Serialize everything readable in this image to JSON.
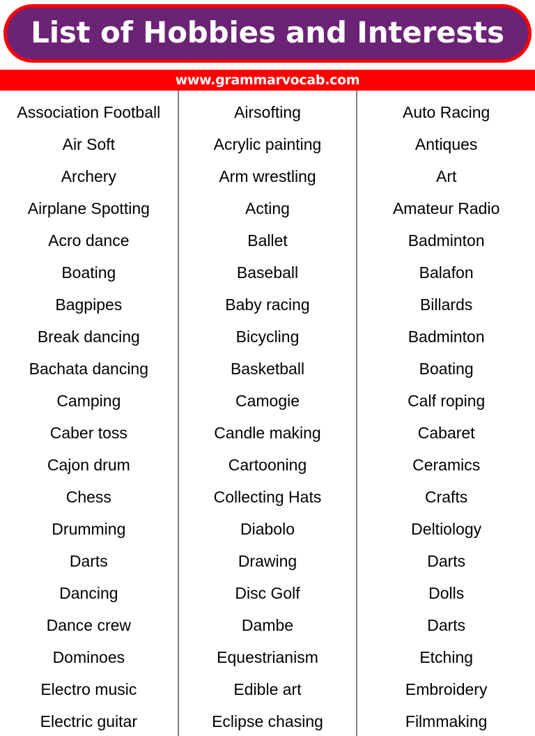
{
  "header": {
    "title": "List of Hobbies and Interests",
    "website": "www.grammarvocab.com",
    "pill_fill_color": "#6B2375",
    "pill_border_color": "#FF0000",
    "banner_color": "#FF0000",
    "title_text_color": "#FFFFFF"
  },
  "list": {
    "column_divider_color": "#808080",
    "text_color": "#000000",
    "columns": [
      {
        "items": [
          "Association Football",
          "Air Soft",
          "Archery",
          "Airplane Spotting",
          "Acro dance",
          "Boating",
          "Bagpipes",
          "Break dancing",
          "Bachata dancing",
          "Camping",
          "Caber toss",
          "Cajon drum",
          "Chess",
          "Drumming",
          "Darts",
          "Dancing",
          "Dance crew",
          "Dominoes",
          "Electro music",
          "Electric guitar"
        ]
      },
      {
        "items": [
          "Airsofting",
          "Acrylic painting",
          "Arm wrestling",
          "Acting",
          "Ballet",
          "Baseball",
          "Baby racing",
          "Bicycling",
          "Basketball",
          "Camogie",
          "Candle making",
          "Cartooning",
          "Collecting Hats",
          "Diabolo",
          "Drawing",
          "Disc Golf",
          "Dambe",
          "Equestrianism",
          "Edible art",
          "Eclipse chasing"
        ]
      },
      {
        "items": [
          "Auto Racing",
          "Antiques",
          "Art",
          "Amateur Radio",
          "Badminton",
          "Balafon",
          "Billards",
          "Badminton",
          "Boating",
          "Calf roping",
          "Cabaret",
          "Ceramics",
          "Crafts",
          "Deltiology",
          "Darts",
          "Dolls",
          "Darts",
          "Etching",
          "Embroidery",
          "Filmmaking"
        ]
      }
    ]
  }
}
